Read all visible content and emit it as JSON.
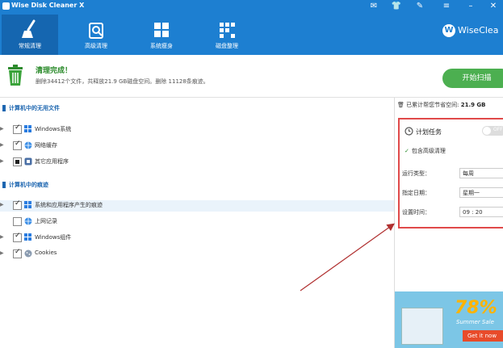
{
  "window": {
    "title": "Wise Disk Cleaner X",
    "controls": [
      "mail-icon",
      "shirt-icon",
      "tools-icon",
      "minimize-icon",
      "close-icon"
    ]
  },
  "nav": {
    "tabs": [
      {
        "label": "常规清理",
        "icon": "broom-icon",
        "active": true
      },
      {
        "label": "高级清理",
        "icon": "trash-search-icon",
        "active": false
      },
      {
        "label": "系统瘦身",
        "icon": "windows-icon",
        "active": false
      },
      {
        "label": "磁盘整理",
        "icon": "defrag-icon",
        "active": false
      }
    ],
    "brand": "WiseClea"
  },
  "status": {
    "title": "清理完成！",
    "desc": "删除34412个文件，共释放21.9 GB磁盘空间。删除 11128条痕迹。",
    "start_button": "开始扫描"
  },
  "left": {
    "section1_title": "计算机中的无用文件",
    "section1_items": [
      {
        "label": "Windows系统",
        "icon": "windows-icon",
        "state": "on"
      },
      {
        "label": "网络缓存",
        "icon": "globe-icon",
        "state": "on"
      },
      {
        "label": "其它应用程序",
        "icon": "app-icon",
        "state": "partial"
      }
    ],
    "section2_title": "计算机中的痕迹",
    "section2_items": [
      {
        "label": "系统和应用程序产生的痕迹",
        "icon": "windows-icon",
        "state": "on",
        "selected": true
      },
      {
        "label": "上网记录",
        "icon": "globe-icon",
        "state": "off"
      },
      {
        "label": "Windows组件",
        "icon": "windows-icon",
        "state": "on"
      },
      {
        "label": "Cookies",
        "icon": "cookie-icon",
        "state": "on"
      }
    ]
  },
  "right": {
    "saved_label": "已累计帮您节省空间:",
    "saved_value": "21.9 GB",
    "schedule": {
      "title": "计划任务",
      "toggle": "OFF",
      "deep_clean": "包含高级清理",
      "run_type_label": "运行类型：",
      "run_type_value": "每周",
      "day_label": "指定日期：",
      "day_value": "星期一",
      "time_label": "设置时间：",
      "time_value": "09 : 20"
    },
    "ad": {
      "percent": "78%",
      "caption": "Summer Sale",
      "button": "Get it now"
    }
  },
  "colors": {
    "accent": "#1d7fd1",
    "success": "#4caf50",
    "highlight": "#e04a4a"
  }
}
